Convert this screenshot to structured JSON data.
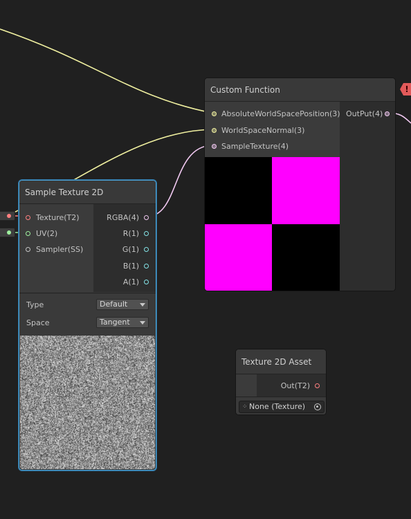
{
  "colors": {
    "background": "#202020",
    "wire_vector3": "#f0f0a0",
    "wire_vector4": "#f0c8f0",
    "port_vector3": "#f0f0a0",
    "port_vector4": "#f0c8f0",
    "port_texture": "#ff8080",
    "port_vector2": "#9ef09e",
    "port_vector1": "#84e4e7",
    "port_sampler": "#c4c4c4",
    "selection": "#4aa3d8",
    "error": "#e25a5a",
    "preview_magenta": "#ff00ff",
    "preview_black": "#000000"
  },
  "error_badge": {
    "icon": "warning-icon",
    "text": "!"
  },
  "custom_function": {
    "title": "Custom Function",
    "inputs": [
      {
        "label": "AbsoluteWorldSpacePosition(3)",
        "type": "vector3"
      },
      {
        "label": "WorldSpaceNormal(3)",
        "type": "vector3"
      },
      {
        "label": "SampleTexture(4)",
        "type": "vector4"
      }
    ],
    "outputs": [
      {
        "label": "OutPut(4)",
        "type": "vector4"
      }
    ],
    "preview": "magenta-black-checker"
  },
  "sample_texture": {
    "title": "Sample Texture 2D",
    "inputs": [
      {
        "label": "Texture(T2)",
        "type": "texture"
      },
      {
        "label": "UV(2)",
        "type": "vector2"
      },
      {
        "label": "Sampler(SS)",
        "type": "sampler"
      }
    ],
    "outputs": [
      {
        "label": "RGBA(4)",
        "type": "vector4"
      },
      {
        "label": "R(1)",
        "type": "vector1"
      },
      {
        "label": "G(1)",
        "type": "vector1"
      },
      {
        "label": "B(1)",
        "type": "vector1"
      },
      {
        "label": "A(1)",
        "type": "vector1"
      }
    ],
    "properties": [
      {
        "label": "Type",
        "value": "Default"
      },
      {
        "label": "Space",
        "value": "Tangent"
      }
    ],
    "preview": "grayscale-noise"
  },
  "texture_asset": {
    "title": "Texture 2D Asset",
    "output": {
      "label": "Out(T2)",
      "type": "texture"
    },
    "field_value": "None (Texture)",
    "field_icon": "texture-icon",
    "picker_icon": "object-picker-icon"
  }
}
